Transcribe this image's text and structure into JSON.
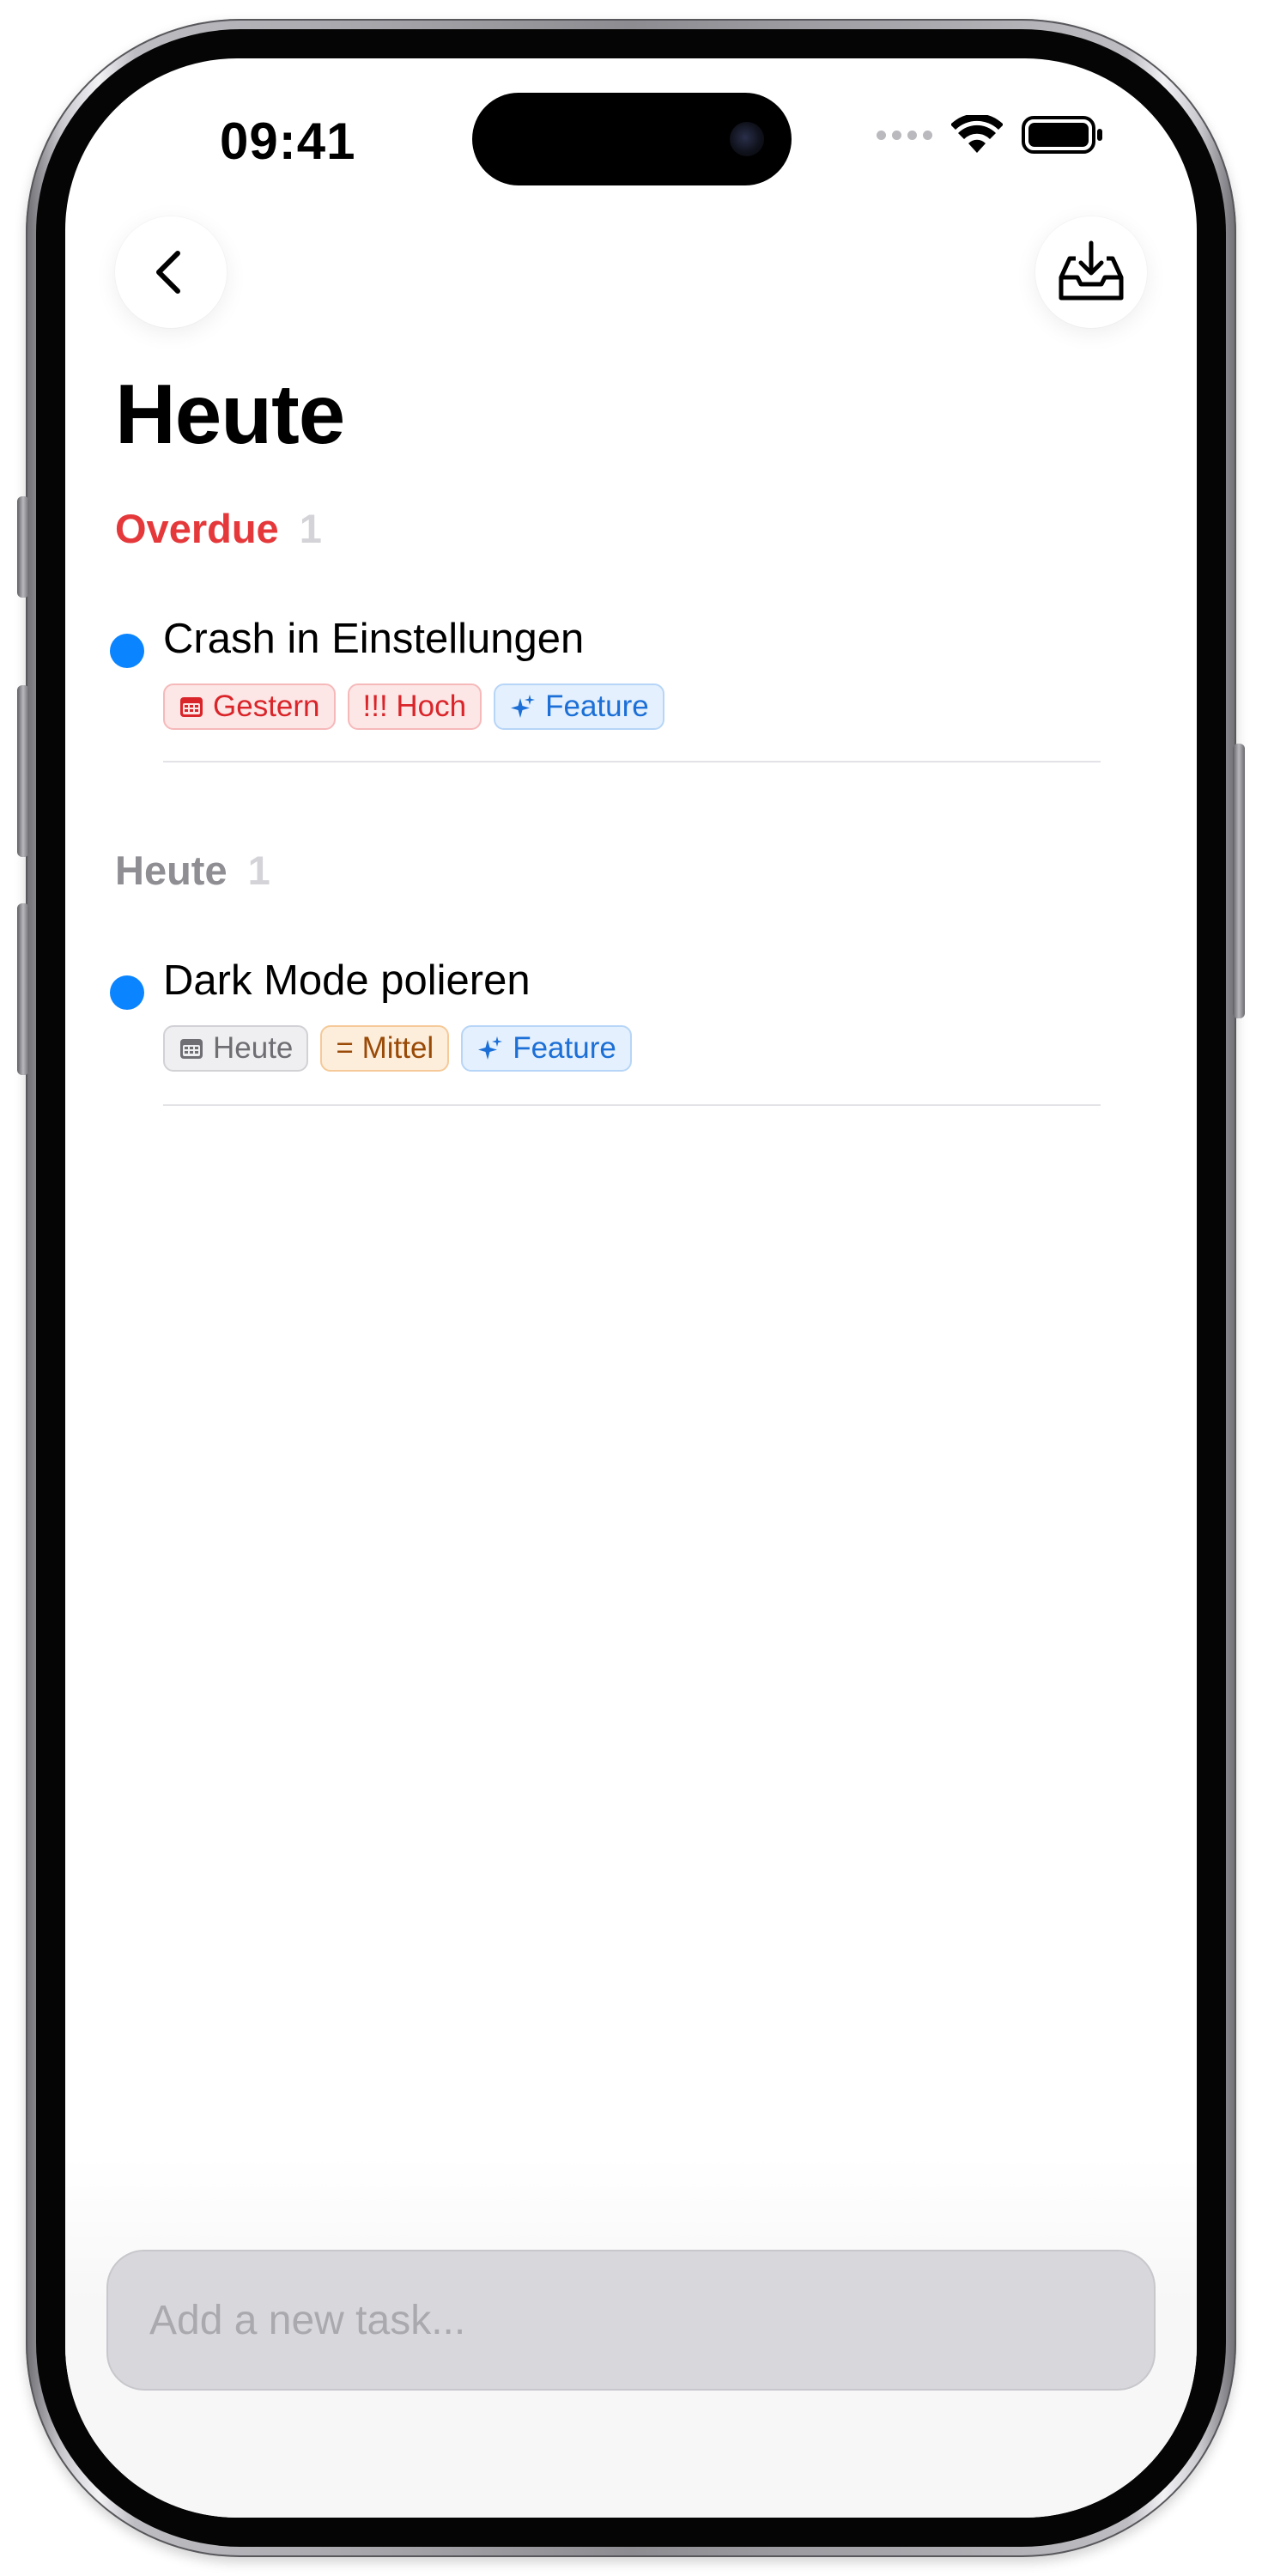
{
  "status_bar": {
    "time": "09:41"
  },
  "nav": {
    "back_icon": "chevron-left-icon",
    "inbox_icon": "inbox-download-icon"
  },
  "page": {
    "title": "Heute"
  },
  "sections": [
    {
      "title": "Overdue",
      "count": "1",
      "color": "#e5383b",
      "tasks": [
        {
          "title": "Crash in Einstellungen",
          "tags": [
            {
              "label": "Gestern",
              "icon": "calendar-icon",
              "style": "red"
            },
            {
              "label": "!!! Hoch",
              "style": "red"
            },
            {
              "label": "Feature",
              "icon": "sparkles-icon",
              "style": "blue"
            }
          ]
        }
      ]
    },
    {
      "title": "Heute",
      "count": "1",
      "color": "#8e8e93",
      "tasks": [
        {
          "title": "Dark Mode polieren",
          "tags": [
            {
              "label": "Heute",
              "icon": "calendar-icon",
              "style": "gray"
            },
            {
              "label": "= Mittel",
              "style": "orange"
            },
            {
              "label": "Feature",
              "icon": "sparkles-icon",
              "style": "blue"
            }
          ]
        }
      ]
    }
  ],
  "composer": {
    "placeholder": "Add a new task..."
  },
  "colors": {
    "accent_blue": "#0a84ff",
    "overdue_red": "#e5383b"
  }
}
